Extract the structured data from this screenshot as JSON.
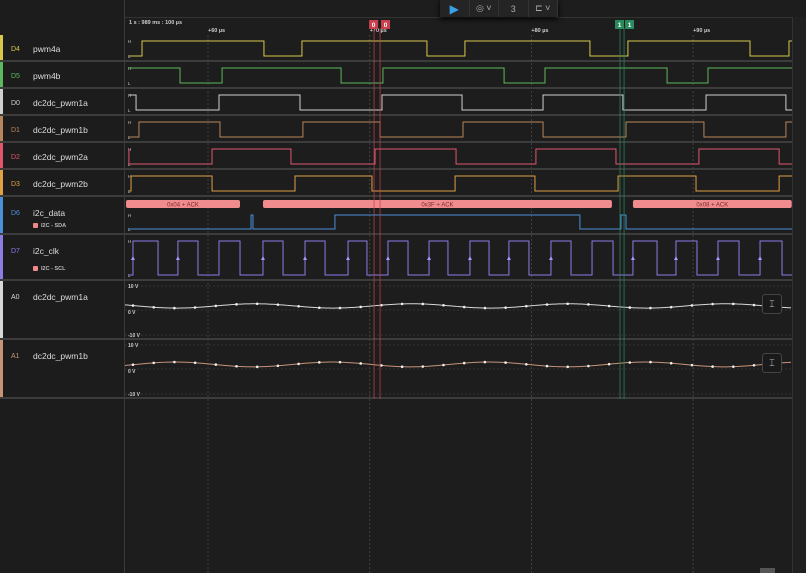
{
  "toolbar": {
    "play": "▶",
    "trigger": "◎ ˅",
    "measure": "3",
    "marker": "⊏ ˅"
  },
  "ruler": {
    "origin": "1 s : 989 ms : 100 µs",
    "ticks": [
      {
        "t": 60,
        "label": "+60 µs"
      },
      {
        "t": 70,
        "label": "+70 µs"
      },
      {
        "t": 80,
        "label": "+80 µs"
      },
      {
        "t": 90,
        "label": "+90 µs"
      }
    ]
  },
  "markers": [
    {
      "label": "0",
      "t": 70.27,
      "color": "#c8404c"
    },
    {
      "label": "0",
      "t": 70.64,
      "color": "#c8404c"
    },
    {
      "label": "1",
      "t": 85.48,
      "color": "#2a8a5e"
    },
    {
      "label": "1",
      "t": 85.73,
      "color": "#2a8a5e"
    }
  ],
  "channels": [
    {
      "id": "D4",
      "name": "pwm4a",
      "color": "#d8c84a",
      "initial": 0,
      "edges_us": [
        55.92,
        63.46,
        65.81,
        73.54,
        75.89,
        83.62,
        85.97,
        93.52,
        95.93
      ]
    },
    {
      "id": "D5",
      "name": "pwm4b",
      "color": "#5cb85c",
      "initial": 1,
      "edges_us": [
        58.27,
        60.87,
        68.23,
        70.82,
        78.31,
        80.84,
        88.39,
        90.92
      ]
    },
    {
      "id": "D0",
      "name": "dc2dc_pwm1a",
      "color": "#d0d0d0",
      "initial": 1,
      "edges_us": [
        55.55,
        60.68,
        65.69,
        70.76,
        75.71,
        80.72,
        85.66,
        90.8,
        95.74
      ]
    },
    {
      "id": "D1",
      "name": "dc2dc_pwm1b",
      "color": "#b8865c",
      "initial": 0,
      "edges_us": [
        55.73,
        60.74,
        65.87,
        70.64,
        75.77,
        80.72,
        85.85,
        90.67,
        95.74
      ]
    },
    {
      "id": "D2",
      "name": "dc2dc_pwm2a",
      "color": "#e0566e",
      "initial": 1,
      "edges_us": [
        55.11,
        60.25,
        65.13,
        70.33,
        75.34,
        80.28,
        85.23,
        90.36,
        95.32
      ]
    },
    {
      "id": "D3",
      "name": "dc2dc_pwm2b",
      "color": "#e0a044",
      "initial": 0,
      "edges_us": [
        55.24,
        60.25,
        65.38,
        70.14,
        75.28,
        80.22,
        85.36,
        90.18,
        95.32
      ]
    },
    {
      "id": "D6",
      "name": "i2c_data",
      "color": "#4a8fd8",
      "analyzer": "I2C - SDA",
      "initial": 0,
      "edges_us": [
        62.66,
        62.78,
        67.85,
        83.0,
        85.54,
        85.85
      ],
      "annotations": [
        {
          "label": "0x04 + ACK",
          "start_us": 54.93,
          "end_us": 61.98
        },
        {
          "label": "0x3F + ACK",
          "start_us": 63.4,
          "end_us": 84.98
        },
        {
          "label": "0x08 + ACK",
          "start_us": 86.28,
          "end_us": 96.1
        }
      ]
    },
    {
      "id": "D7",
      "name": "i2c_clk",
      "color": "#8c7ce6",
      "analyzer": "I2C - SCL",
      "initial": 0,
      "edges_us": [
        55.36,
        56.91,
        58.14,
        59.38,
        60.68,
        61.98,
        63.4,
        64.64,
        66.0,
        67.24,
        68.66,
        69.83,
        71.13,
        72.37,
        73.67,
        74.84,
        76.2,
        77.38,
        78.61,
        79.85,
        81.21,
        82.45,
        83.75,
        85.05,
        86.28,
        87.77,
        88.94,
        90.24,
        91.54,
        92.84,
        94.14,
        95.5
      ],
      "sample_arrows_us": [
        55.36,
        58.14,
        63.4,
        66.0,
        68.66,
        71.13,
        73.67,
        76.2,
        78.61,
        81.21,
        86.28,
        88.94,
        91.54,
        94.14
      ]
    }
  ],
  "analog": [
    {
      "id": "A0",
      "name": "dc2dc_pwm1a",
      "color": "#d8d8d8",
      "offset_v": 1.7,
      "amplitude_v": 0.9,
      "period_us": 9.7,
      "peak_us": 62.9
    },
    {
      "id": "A1",
      "name": "dc2dc_pwm1b",
      "color": "#c89478",
      "offset_v": 1.9,
      "amplitude_v": 1.0,
      "period_us": 9.7,
      "peak_us": 57.96
    }
  ],
  "analog_axis": {
    "max": "10 V",
    "zero": "0 V",
    "min": "-10 V",
    "range_v": 10
  },
  "levels": {
    "high": "H",
    "low": "L"
  },
  "zoom_fit_icon": "⌶"
}
